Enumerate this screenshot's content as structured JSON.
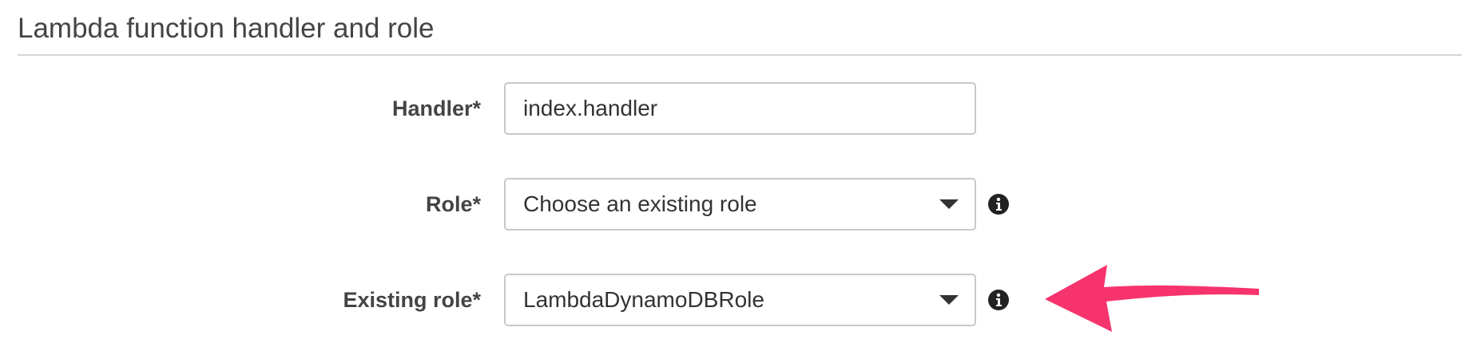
{
  "section": {
    "title": "Lambda function handler and role"
  },
  "form": {
    "handler": {
      "label": "Handler*",
      "value": "index.handler"
    },
    "role": {
      "label": "Role*",
      "selected": "Choose an existing role",
      "info_icon": "info-circle-icon"
    },
    "existing_role": {
      "label": "Existing role*",
      "selected": "LambdaDynamoDBRole",
      "info_icon": "info-circle-icon"
    }
  },
  "annotation": {
    "arrow_icon": "pointer-arrow-icon",
    "arrow_color": "#f7336d"
  },
  "colors": {
    "border": "#c8c8c8",
    "divider": "#d6d6d6",
    "text": "#333333"
  }
}
